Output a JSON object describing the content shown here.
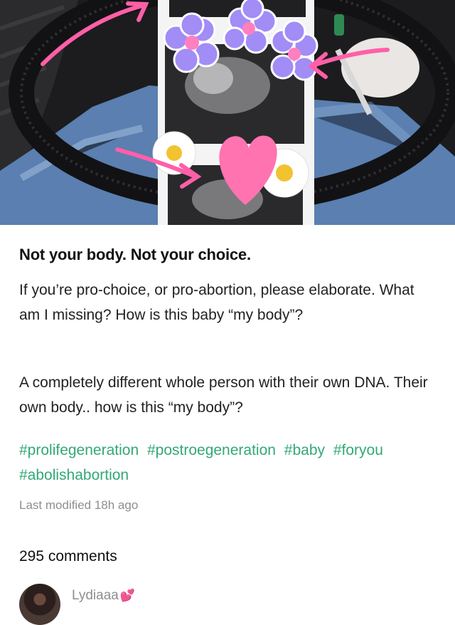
{
  "post": {
    "title": "Not your body. Not your choice.",
    "paragraph1": "If you’re pro-choice, or pro-abortion, please elaborate. What am I missing? How is this baby “my body”?",
    "paragraph2": "A completely different whole person with their own DNA. Their own body.. how is this “my body”?",
    "hashtags": [
      "#prolifegeneration",
      "#postroegeneration",
      "#baby",
      "#foryou",
      "#abolishabortion"
    ],
    "last_modified": "Last modified 18h ago"
  },
  "comments": {
    "count_label": "295 comments",
    "first": {
      "author": "Lydiaaa",
      "emoji": "💕"
    }
  },
  "colors": {
    "hashtag": "#33a877",
    "muted": "#8e8e93",
    "sticker_pink": "#ff5fa8",
    "flower_purple": "#a28cf6"
  },
  "icons": [
    "arrow-sticker",
    "flower-sticker",
    "daisy-sticker",
    "heart-sticker"
  ]
}
